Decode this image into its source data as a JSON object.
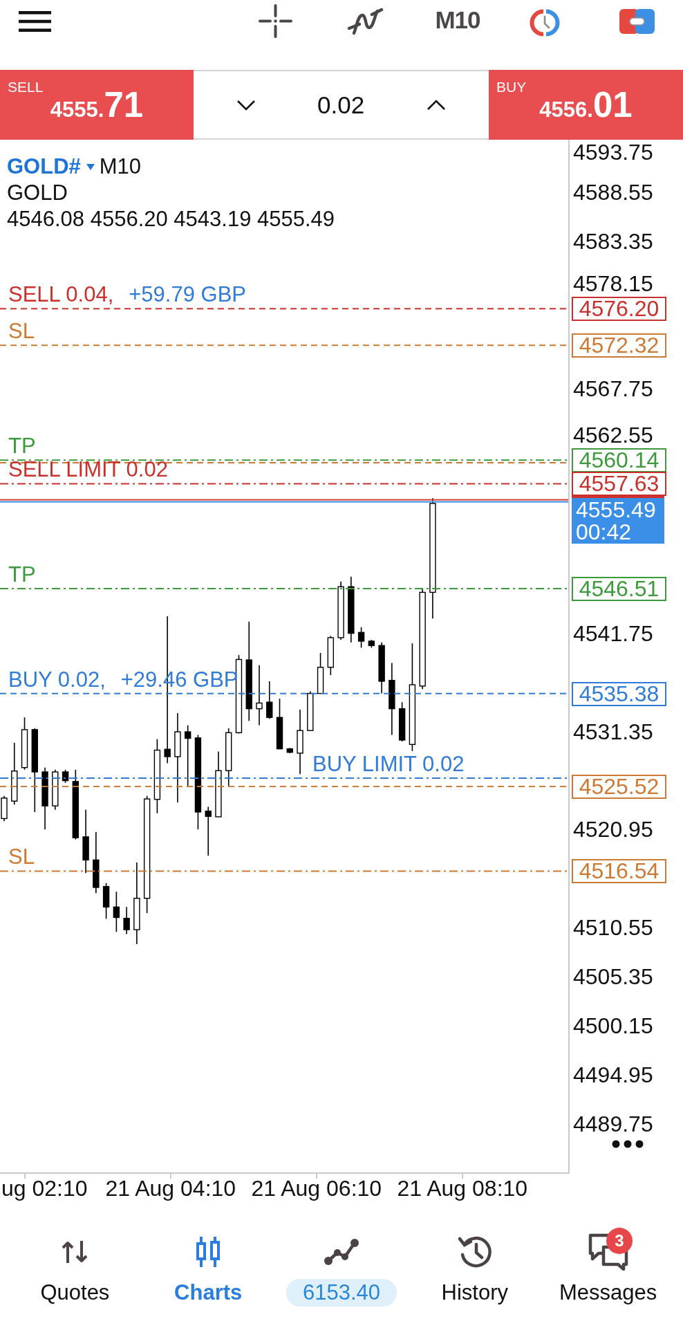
{
  "top_bar": {
    "timeframe": "M10"
  },
  "trade_panel": {
    "sell": {
      "label": "SELL",
      "price": "4555.",
      "price_large": "71"
    },
    "volume": "0.02",
    "buy": {
      "label": "BUY",
      "price": "4556.",
      "price_large": "01"
    }
  },
  "chart": {
    "symbol": "GOLD#",
    "timeframe": "M10",
    "description": "GOLD",
    "ohlc": "4546.08 4556.20 4543.19 4555.49",
    "order_lines": [
      {
        "kind": "dashed",
        "color": "#c9302c",
        "label": "SELL 0.04,",
        "profit": "+59.79 GBP",
        "price": "4576.20"
      },
      {
        "kind": "dashed",
        "color": "#cc7a33",
        "label": "SL",
        "price": "4572.32"
      },
      {
        "kind": "dashdot",
        "color": "#3c9a3c",
        "label": "TP",
        "price": "4560.14"
      },
      {
        "kind": "dashed",
        "color": "#cc7a33"
      },
      {
        "kind": "dashdot",
        "color": "#c9302c",
        "label": "SELL LIMIT 0.02",
        "price": "4557.63"
      },
      {
        "kind": "dashdot",
        "color": "#3c9a3c",
        "label": "TP",
        "price": "4546.51"
      },
      {
        "kind": "dashed",
        "color": "#2f7bd6",
        "label": "BUY 0.02,",
        "profit": "+29.46 GBP",
        "price": "4535.38"
      },
      {
        "kind": "dashdot",
        "color": "#2f7bd6",
        "label": "BUY LIMIT 0.02"
      },
      {
        "kind": "dashed",
        "color": "#cc7a33",
        "price": "4525.52"
      },
      {
        "kind": "dashdot",
        "color": "#cc7a33",
        "label": "SL",
        "price": "4516.54"
      }
    ],
    "current_price": {
      "price": "4555.49",
      "countdown": "00:42"
    },
    "price_axis": [
      "4593.75",
      "4588.55",
      "4583.35",
      "4578.15",
      "4567.75",
      "4562.55",
      "4541.75",
      "4531.35",
      "4520.95",
      "4510.55",
      "4505.35",
      "4500.15",
      "4494.95",
      "4489.75"
    ],
    "time_axis": [
      "ug 02:10",
      "21 Aug 04:10",
      "21 Aug 06:10",
      "21 Aug 08:10"
    ]
  },
  "bottom_nav": [
    {
      "kind": "tab",
      "label": "Quotes",
      "selected": false
    },
    {
      "kind": "tab",
      "label": "Charts",
      "selected": true
    },
    {
      "kind": "balance",
      "label": "6153.40",
      "selected": false
    },
    {
      "kind": "tab",
      "label": "History",
      "selected": false
    },
    {
      "kind": "tab",
      "label": "Messages",
      "selected": false,
      "badge": "3"
    }
  ]
}
